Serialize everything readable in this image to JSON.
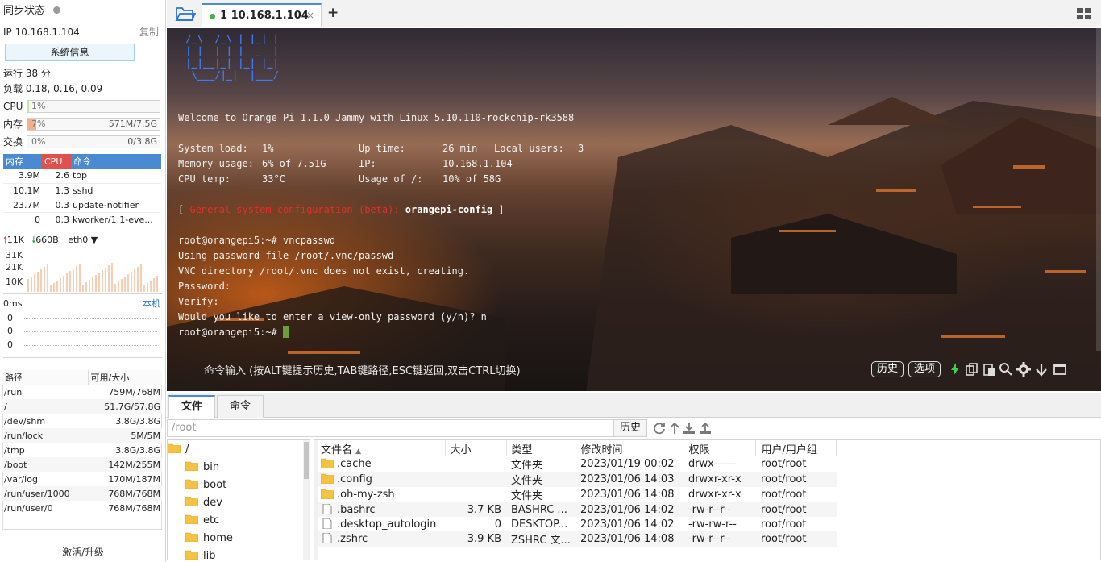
{
  "left": {
    "sync_title": "同步状态",
    "ip": "IP 10.168.1.104",
    "copy_label": "复制",
    "sysinfo_label": "系统信息",
    "uptime": "运行 38 分",
    "load": "负载 0.18, 0.16, 0.09",
    "cpu": {
      "label": "CPU",
      "pct_text": "1%",
      "value": 0.01
    },
    "mem": {
      "label": "内存",
      "pct_text": "7%",
      "value": 0.07,
      "usage": "571M/7.5G"
    },
    "swap": {
      "label": "交换",
      "pct_text": "0%",
      "value": 0.0,
      "usage": "0/3.8G"
    },
    "proc_headers": {
      "mem": "内存",
      "cpu": "CPU",
      "cmd": "命令"
    },
    "procs": [
      {
        "mem": "3.9M",
        "cpu": "2.6",
        "cmd": "top"
      },
      {
        "mem": "10.1M",
        "cpu": "1.3",
        "cmd": "sshd"
      },
      {
        "mem": "23.7M",
        "cpu": "0.3",
        "cmd": "update-notifier"
      },
      {
        "mem": "0",
        "cpu": "0.3",
        "cmd": "kworker/1:1-eve..."
      }
    ],
    "net": {
      "up": "11K",
      "down": "660B",
      "iface": "eth0"
    },
    "net_chart_ticks": [
      "31K",
      "21K",
      "10K"
    ],
    "latency": {
      "label": "0ms",
      "local": "本机",
      "ticks": [
        "0",
        "0",
        "0"
      ]
    },
    "disk_headers": {
      "path": "路径",
      "size": "可用/大小"
    },
    "disks": [
      {
        "path": "/run",
        "size": "759M/768M"
      },
      {
        "path": "/",
        "size": "51.7G/57.8G"
      },
      {
        "path": "/dev/shm",
        "size": "3.8G/3.8G"
      },
      {
        "path": "/run/lock",
        "size": "5M/5M"
      },
      {
        "path": "/tmp",
        "size": "3.8G/3.8G"
      },
      {
        "path": "/boot",
        "size": "142M/255M"
      },
      {
        "path": "/var/log",
        "size": "170M/187M"
      },
      {
        "path": "/run/user/1000",
        "size": "768M/768M"
      },
      {
        "path": "/run/user/0",
        "size": "768M/768M"
      }
    ],
    "activate_label": "激活/升级"
  },
  "tabs": {
    "active_label": "1 10.168.1.104",
    "close_glyph": "×",
    "add_glyph": "+"
  },
  "terminal": {
    "logo": [
      " /_\\  /_\\ | |_| | ",
      " | |  | | |  _  | ",
      " |_|__|_| |_| |_| ",
      "  \\___/|_|  |___/ "
    ],
    "welcome": "Welcome to Orange Pi 1.1.0 Jammy with Linux 5.10.110-rockchip-rk3588",
    "sysload_label": "System load:",
    "sysload": "1%",
    "uptime_label": "Up time:",
    "uptime": "26 min",
    "users_label": "Local users:",
    "users": "3",
    "memusage_label": "Memory usage:",
    "memusage": "6% of 7.51G",
    "ip_label": "IP:",
    "ip": "10.168.1.104",
    "cputemp_label": "CPU temp:",
    "cputemp": "33°C",
    "disk_label": "Usage of /:",
    "disk": "10% of 58G",
    "config_open": "[ ",
    "config_red": "General system configuration (beta):",
    "config_cmd": "orangepi-config",
    "config_close": " ]",
    "lines": [
      "root@orangepi5:~# vncpasswd",
      "Using password file /root/.vnc/passwd",
      "VNC directory /root/.vnc does not exist, creating.",
      "Password:",
      "Verify:",
      "Would you like to enter a view-only password (y/n)? n"
    ],
    "prompt": "root@orangepi5:~# ",
    "cmd_hint": "命令输入 (按ALT键提示历史,TAB键路径,ESC键返回,双击CTRL切换)",
    "history_btn": "历史",
    "options_btn": "选项"
  },
  "bottom": {
    "tab_files": "文件",
    "tab_commands": "命令",
    "path": "/root",
    "history_btn": "历史",
    "tree": [
      {
        "name": "/",
        "level": 0
      },
      {
        "name": "bin",
        "level": 1
      },
      {
        "name": "boot",
        "level": 1
      },
      {
        "name": "dev",
        "level": 1
      },
      {
        "name": "etc",
        "level": 1
      },
      {
        "name": "home",
        "level": 1
      },
      {
        "name": "lib",
        "level": 1
      }
    ],
    "file_headers": {
      "name": "文件名",
      "size": "大小",
      "type": "类型",
      "mtime": "修改时间",
      "perm": "权限",
      "owner": "用户/用户组"
    },
    "files": [
      {
        "name": ".cache",
        "size": "",
        "type": "文件夹",
        "mtime": "2023/01/19 00:02",
        "perm": "drwx------",
        "owner": "root/root",
        "icon": "folder-icon"
      },
      {
        "name": ".config",
        "size": "",
        "type": "文件夹",
        "mtime": "2023/01/06 14:03",
        "perm": "drwxr-xr-x",
        "owner": "root/root",
        "icon": "folder-icon"
      },
      {
        "name": ".oh-my-zsh",
        "size": "",
        "type": "文件夹",
        "mtime": "2023/01/06 14:08",
        "perm": "drwxr-xr-x",
        "owner": "root/root",
        "icon": "folder-icon"
      },
      {
        "name": ".bashrc",
        "size": "3.7 KB",
        "type": "BASHRC ...",
        "mtime": "2023/01/06 14:02",
        "perm": "-rw-r--r--",
        "owner": "root/root",
        "icon": "file-icon"
      },
      {
        "name": ".desktop_autologin",
        "size": "0",
        "type": "DESKTOP...",
        "mtime": "2023/01/06 14:02",
        "perm": "-rw-rw-r--",
        "owner": "root/root",
        "icon": "file-icon"
      },
      {
        "name": ".zshrc",
        "size": "3.9 KB",
        "type": "ZSHRC 文...",
        "mtime": "2023/01/06 14:08",
        "perm": "-rw-r--r--",
        "owner": "root/root",
        "icon": "file-icon"
      }
    ]
  },
  "colors": {
    "accent": "#4a8ad2",
    "cpu_header": "#e0504d",
    "mem_fill": "#f4b08a",
    "cpu_fill": "#c9e6a8",
    "prompt_green": "#3bb44a"
  }
}
